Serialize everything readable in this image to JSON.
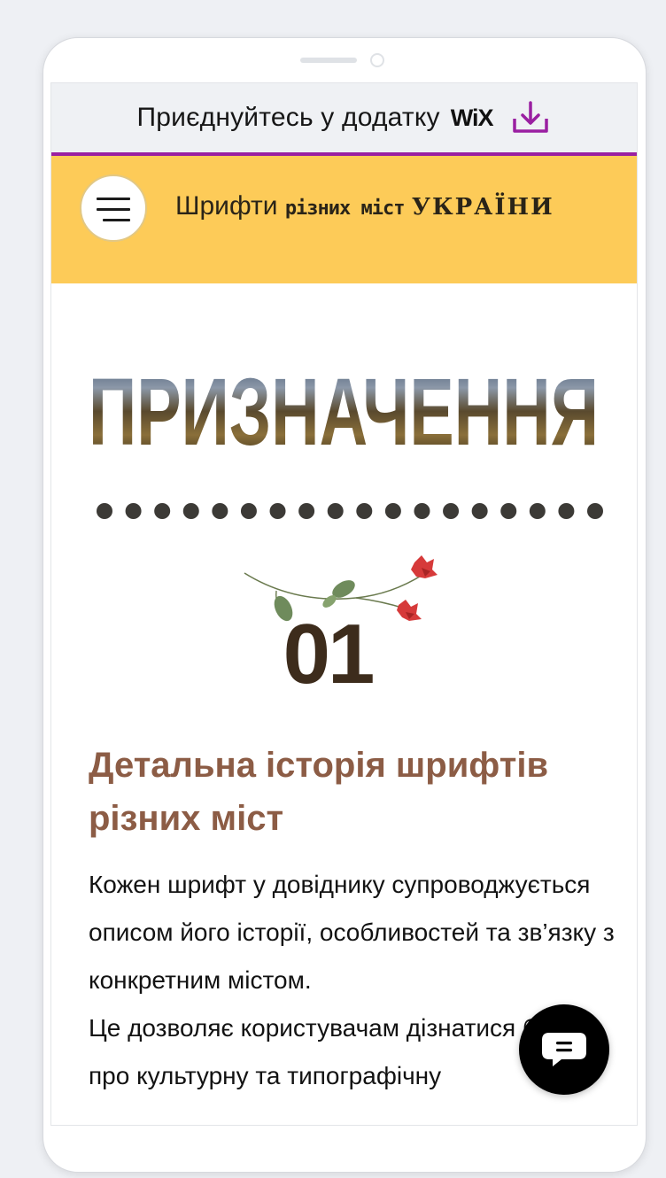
{
  "banner": {
    "text": "Приєднуйтесь у додатку",
    "brand": "WiX",
    "icon": "download-icon",
    "accent_color": "#9a1fa1"
  },
  "header": {
    "menu_icon": "hamburger-menu-icon",
    "title_part1": "Шрифти",
    "title_part2": "різних міст",
    "title_part3": "УКРАЇНИ",
    "background_color": "#fdcb58"
  },
  "hero": {
    "title": "ПРИЗНАЧЕННЯ",
    "dot_count": 18
  },
  "step": {
    "number": "01",
    "decoration_icon": "floral-branch-icon",
    "heading": "Детальна історія шрифтів різних міст",
    "paragraphs": [
      "Кожен шрифт у довіднику супроводжується описом його історії, особливостей та зв’язку з конкретним містом.",
      "Це дозволяє користувачам дізнатися більше про культурну та типографічну"
    ]
  },
  "chat": {
    "icon": "chat-bubble-icon"
  }
}
